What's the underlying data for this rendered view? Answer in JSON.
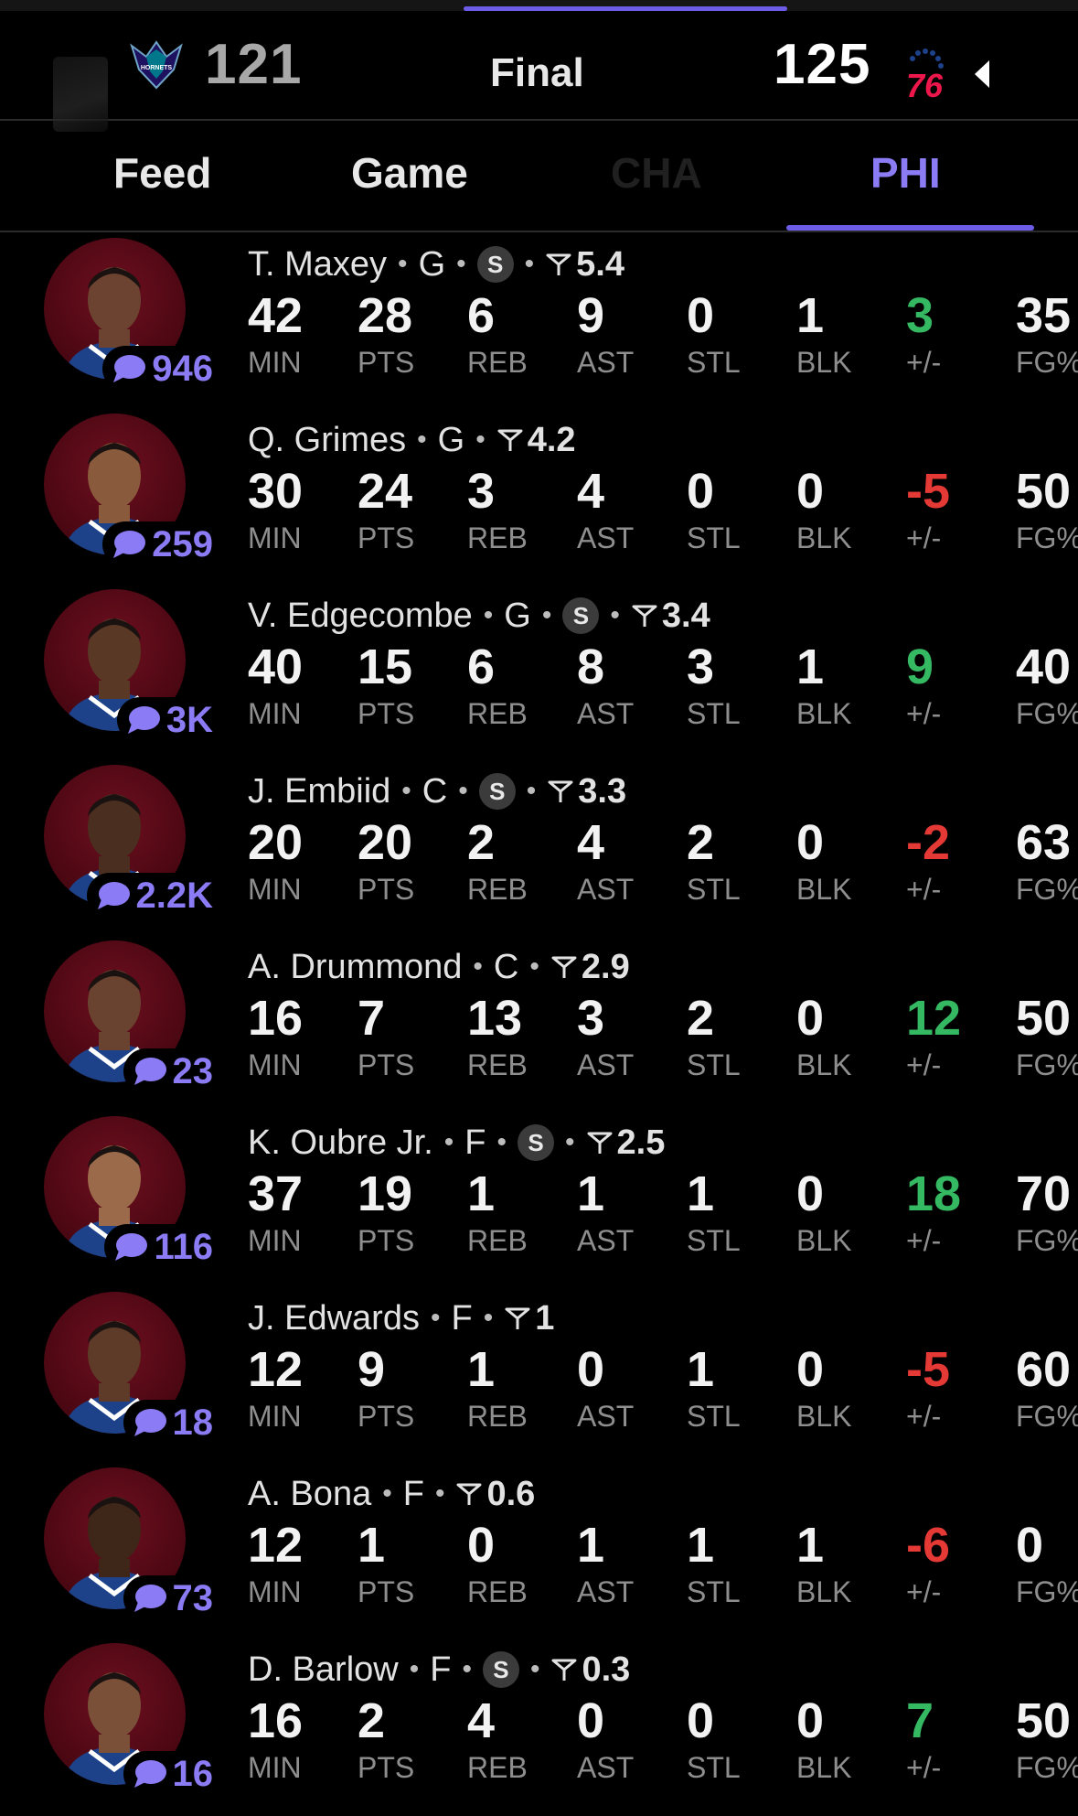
{
  "scoreboard": {
    "away_score": "121",
    "status": "Final",
    "home_score": "125",
    "hornets_logo_text": "HORNETS",
    "sixers_logo_text": "76"
  },
  "tabs": [
    {
      "label": "Feed"
    },
    {
      "label": "Game"
    },
    {
      "label": "CHA"
    },
    {
      "label": "PHI"
    }
  ],
  "stat_labels": [
    "MIN",
    "PTS",
    "REB",
    "AST",
    "STL",
    "BLK",
    "+/-",
    "FG%"
  ],
  "players": [
    {
      "name": "T. Maxey",
      "pos": "G",
      "starter": true,
      "rating": "5.4",
      "comments": "946",
      "stats": [
        "42",
        "28",
        "6",
        "9",
        "0",
        "1",
        "3",
        "35"
      ],
      "pm_sign": "positive"
    },
    {
      "name": "Q. Grimes",
      "pos": "G",
      "starter": false,
      "rating": "4.2",
      "comments": "259",
      "stats": [
        "30",
        "24",
        "3",
        "4",
        "0",
        "0",
        "-5",
        "50"
      ],
      "pm_sign": "negative"
    },
    {
      "name": "V. Edgecombe",
      "pos": "G",
      "starter": true,
      "rating": "3.4",
      "comments": "3K",
      "stats": [
        "40",
        "15",
        "6",
        "8",
        "3",
        "1",
        "9",
        "40"
      ],
      "pm_sign": "positive"
    },
    {
      "name": "J. Embiid",
      "pos": "C",
      "starter": true,
      "rating": "3.3",
      "comments": "2.2K",
      "stats": [
        "20",
        "20",
        "2",
        "4",
        "2",
        "0",
        "-2",
        "63"
      ],
      "pm_sign": "negative"
    },
    {
      "name": "A. Drummond",
      "pos": "C",
      "starter": false,
      "rating": "2.9",
      "comments": "23",
      "stats": [
        "16",
        "7",
        "13",
        "3",
        "2",
        "0",
        "12",
        "50"
      ],
      "pm_sign": "positive"
    },
    {
      "name": "K. Oubre Jr.",
      "pos": "F",
      "starter": true,
      "rating": "2.5",
      "comments": "116",
      "stats": [
        "37",
        "19",
        "1",
        "1",
        "1",
        "0",
        "18",
        "70"
      ],
      "pm_sign": "positive"
    },
    {
      "name": "J. Edwards",
      "pos": "F",
      "starter": false,
      "rating": "1",
      "comments": "18",
      "stats": [
        "12",
        "9",
        "1",
        "0",
        "1",
        "0",
        "-5",
        "60"
      ],
      "pm_sign": "negative"
    },
    {
      "name": "A. Bona",
      "pos": "F",
      "starter": false,
      "rating": "0.6",
      "comments": "73",
      "stats": [
        "12",
        "1",
        "0",
        "1",
        "1",
        "1",
        "-6",
        "0"
      ],
      "pm_sign": "negative"
    },
    {
      "name": "D. Barlow",
      "pos": "F",
      "starter": true,
      "rating": "0.3",
      "comments": "16",
      "stats": [
        "16",
        "2",
        "4",
        "0",
        "0",
        "0",
        "7",
        "50"
      ],
      "pm_sign": "positive"
    }
  ],
  "icons": {
    "comment": "chat-bubble-icon",
    "rating": "pennant-flag-icon",
    "back": "triangle-left-icon"
  },
  "colors": {
    "accent": "#8b7cf6",
    "positive": "#35b862",
    "negative": "#e53935",
    "label": "#8e8e8e",
    "avatar_bg": "#5a0a18"
  }
}
